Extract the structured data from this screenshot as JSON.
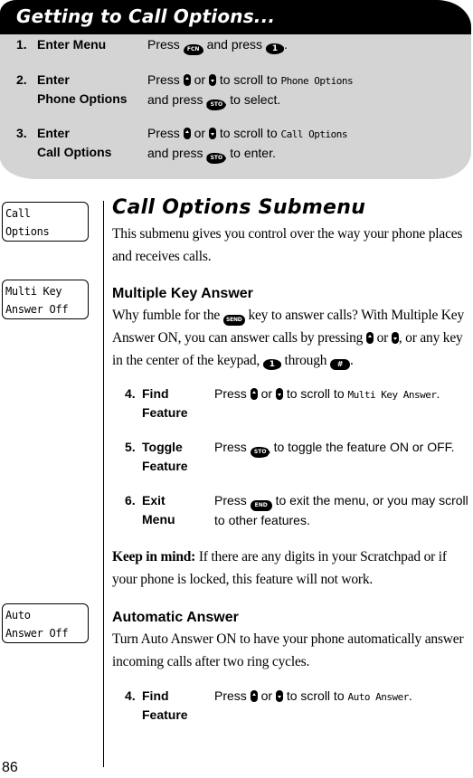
{
  "panel": {
    "title": "Getting to Call Options...",
    "steps": [
      {
        "num": "1.",
        "label_lines": [
          "Enter Menu"
        ],
        "desc": {
          "press": "Press",
          "key1": "FCN",
          "mid": "and press",
          "key2": "1",
          "end": "."
        }
      },
      {
        "num": "2.",
        "label_lines": [
          "Enter",
          "Phone Options"
        ],
        "desc": {
          "press": "Press",
          "or": "or",
          "scroll": "to scroll to",
          "lcd": "Phone Options",
          "and_press": "and press",
          "key": "STO",
          "end": "to select."
        }
      },
      {
        "num": "3.",
        "label_lines": [
          "Enter",
          "Call Options"
        ],
        "desc": {
          "press": "Press",
          "or": "or",
          "scroll": "to scroll to",
          "lcd": "Call Options",
          "and_press": "and press",
          "key": "STO",
          "end": "to enter."
        }
      }
    ]
  },
  "section": {
    "title": "Call Options Submenu",
    "intro": "This submenu gives you control over the way your phone places and receives calls."
  },
  "lcd_displays": [
    {
      "line1": "Call",
      "line2": "Options"
    },
    {
      "line1": "Multi Key",
      "line2": "Answer Off"
    },
    {
      "line1": "Auto",
      "line2": "Answer Off"
    }
  ],
  "multi_key": {
    "heading": "Multiple Key Answer",
    "p1": "Why fumble for the",
    "key_send": "SEND",
    "p2": "key to answer calls? With Multiple Key Answer ON, you can answer calls by pressing",
    "p3": "or",
    "p4": ", or any key in the center of the keypad,",
    "key_one": "1",
    "p5": "through",
    "key_hash": "#",
    "p6": ".",
    "steps": [
      {
        "num": "4.",
        "label_lines": [
          "Find",
          "Feature"
        ],
        "press": "Press",
        "or": "or",
        "scroll": "to scroll to",
        "lcd": "Multi Key Answer",
        "end": "."
      },
      {
        "num": "5.",
        "label_lines": [
          "Toggle",
          "Feature"
        ],
        "press": "Press",
        "key": "STO",
        "text": "to toggle the feature ON or OFF."
      },
      {
        "num": "6.",
        "label_lines": [
          "Exit",
          "Menu"
        ],
        "press": "Press",
        "key": "END",
        "text": "to exit the menu, or you may scroll to other features."
      }
    ],
    "note_bold": "Keep in mind:",
    "note_text": "If there are any digits in your Scratchpad or if your phone is locked, this feature will not work."
  },
  "auto_answer": {
    "heading": "Automatic Answer",
    "text": "Turn Auto Answer ON to have your phone automatically answer incoming calls after two ring cycles.",
    "steps": [
      {
        "num": "4.",
        "label_lines": [
          "Find",
          "Feature"
        ],
        "press": "Press",
        "or": "or",
        "scroll": "to scroll to",
        "lcd": "Auto Answer",
        "end": "."
      }
    ]
  },
  "page_number": "86"
}
